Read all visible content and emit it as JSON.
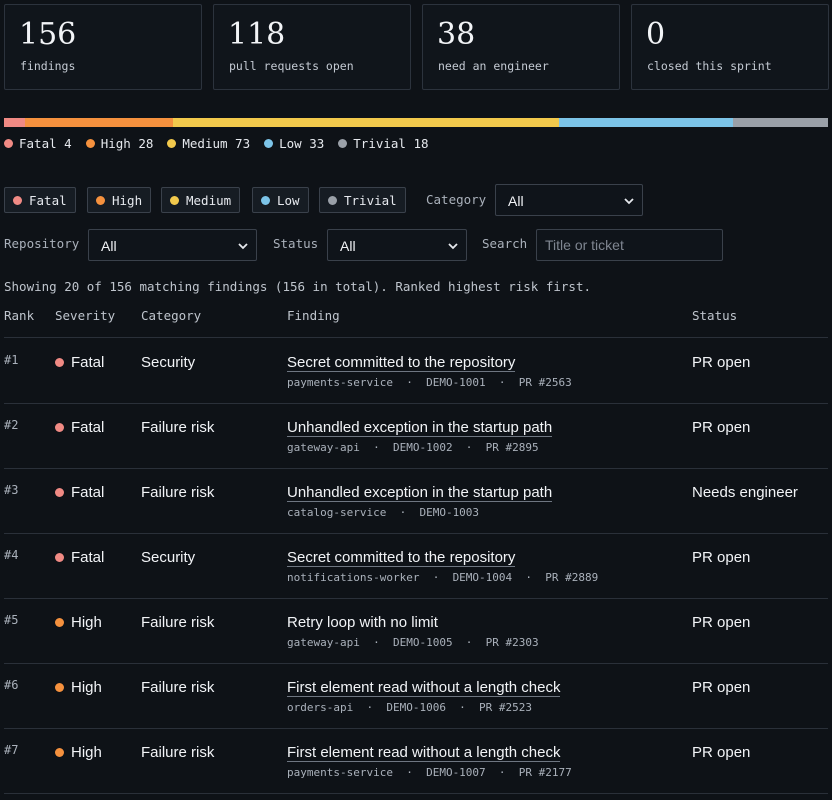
{
  "stats": [
    {
      "value": "156",
      "label": "findings"
    },
    {
      "value": "118",
      "label": "pull requests open"
    },
    {
      "value": "38",
      "label": "need an engineer"
    },
    {
      "value": "0",
      "label": "closed this sprint"
    }
  ],
  "colors": {
    "Fatal": "#f08a84",
    "High": "#f5913e",
    "Medium": "#f2c94c",
    "Low": "#7cc4e8",
    "Trivial": "#9aa0a8"
  },
  "severity_counts": [
    {
      "name": "Fatal",
      "count": 4,
      "text": "Fatal 4"
    },
    {
      "name": "High",
      "count": 28,
      "text": "High 28"
    },
    {
      "name": "Medium",
      "count": 73,
      "text": "Medium 73"
    },
    {
      "name": "Low",
      "count": 33,
      "text": "Low 33"
    },
    {
      "name": "Trivial",
      "count": 18,
      "text": "Trivial 18"
    }
  ],
  "filters": {
    "chips": [
      "Fatal",
      "High",
      "Medium",
      "Low",
      "Trivial"
    ],
    "category_label": "Category",
    "category_value": "All",
    "repository_label": "Repository",
    "repository_value": "All",
    "status_label": "Status",
    "status_value": "All",
    "search_label": "Search",
    "search_placeholder": "Title or ticket"
  },
  "showing_text": "Showing 20 of 156 matching findings (156 in total). Ranked highest risk first.",
  "columns": {
    "rank": "Rank",
    "severity": "Severity",
    "category": "Category",
    "finding": "Finding",
    "status": "Status"
  },
  "rows": [
    {
      "rank": "#1",
      "severity": "Fatal",
      "category": "Security",
      "title": "Secret committed to the repository",
      "linked": true,
      "meta": "payments-service  ·  DEMO-1001  ·  PR #2563",
      "status": "PR open"
    },
    {
      "rank": "#2",
      "severity": "Fatal",
      "category": "Failure risk",
      "title": "Unhandled exception in the startup path",
      "linked": true,
      "meta": "gateway-api  ·  DEMO-1002  ·  PR #2895",
      "status": "PR open"
    },
    {
      "rank": "#3",
      "severity": "Fatal",
      "category": "Failure risk",
      "title": "Unhandled exception in the startup path",
      "linked": true,
      "meta": "catalog-service  ·  DEMO-1003",
      "status": "Needs engineer"
    },
    {
      "rank": "#4",
      "severity": "Fatal",
      "category": "Security",
      "title": "Secret committed to the repository",
      "linked": true,
      "meta": "notifications-worker  ·  DEMO-1004  ·  PR #2889",
      "status": "PR open"
    },
    {
      "rank": "#5",
      "severity": "High",
      "category": "Failure risk",
      "title": "Retry loop with no limit",
      "linked": false,
      "meta": "gateway-api  ·  DEMO-1005  ·  PR #2303",
      "status": "PR open"
    },
    {
      "rank": "#6",
      "severity": "High",
      "category": "Failure risk",
      "title": "First element read without a length check",
      "linked": true,
      "meta": "orders-api  ·  DEMO-1006  ·  PR #2523",
      "status": "PR open"
    },
    {
      "rank": "#7",
      "severity": "High",
      "category": "Failure risk",
      "title": "First element read without a length check",
      "linked": true,
      "meta": "payments-service  ·  DEMO-1007  ·  PR #2177",
      "status": "PR open"
    }
  ]
}
